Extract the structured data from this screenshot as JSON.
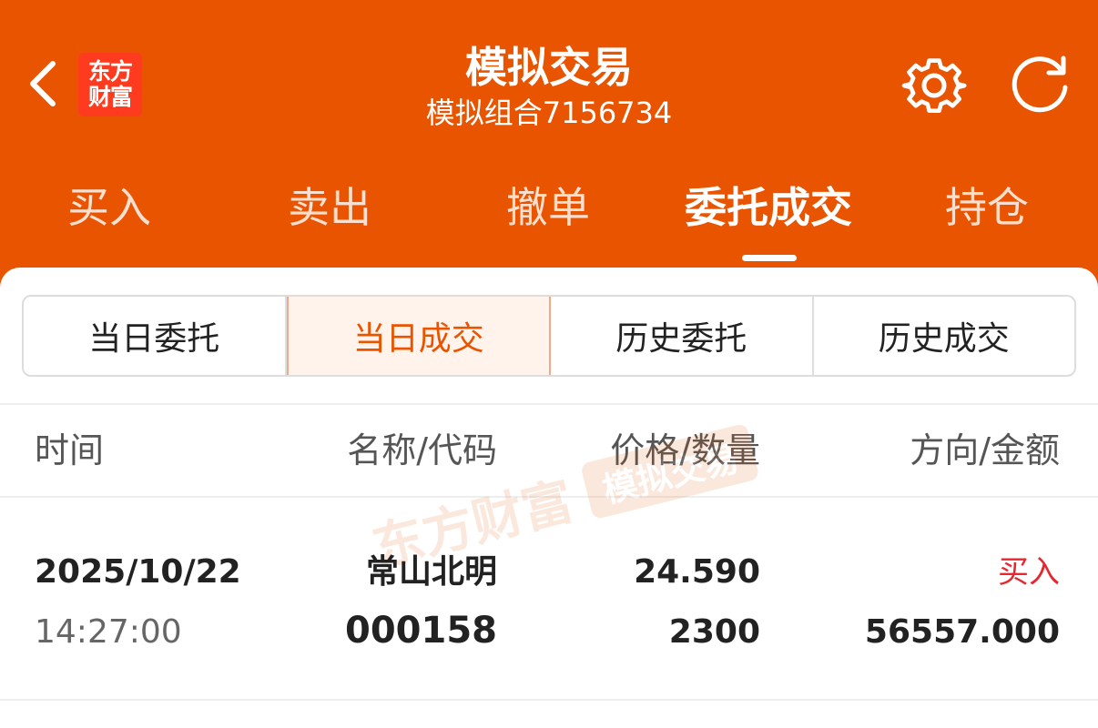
{
  "header": {
    "title": "模拟交易",
    "subtitle": "模拟组合7156734",
    "logo_line1": "东方",
    "logo_line2": "财富",
    "bg_color": "#e85400"
  },
  "tabs": [
    {
      "label": "买入"
    },
    {
      "label": "卖出"
    },
    {
      "label": "撤单"
    },
    {
      "label": "委托成交",
      "active": true
    },
    {
      "label": "持仓"
    }
  ],
  "segments": [
    {
      "label": "当日委托"
    },
    {
      "label": "当日成交",
      "active": true
    },
    {
      "label": "历史委托"
    },
    {
      "label": "历史成交"
    }
  ],
  "columns": {
    "time": "时间",
    "name_code": "名称/代码",
    "price_qty": "价格/数量",
    "dir_amount": "方向/金额"
  },
  "trades": [
    {
      "date": "2025/10/22",
      "time": "14:27:00",
      "name": "常山北明",
      "code": "000158",
      "price": "24.590",
      "quantity": "2300",
      "direction": "买入",
      "amount": "56557.000",
      "direction_color": "#e8262f"
    }
  ],
  "watermark": {
    "brand": "东方财富",
    "label": "模拟交易"
  },
  "icons": [
    "chevron-left-icon",
    "gear-icon",
    "refresh-icon"
  ]
}
